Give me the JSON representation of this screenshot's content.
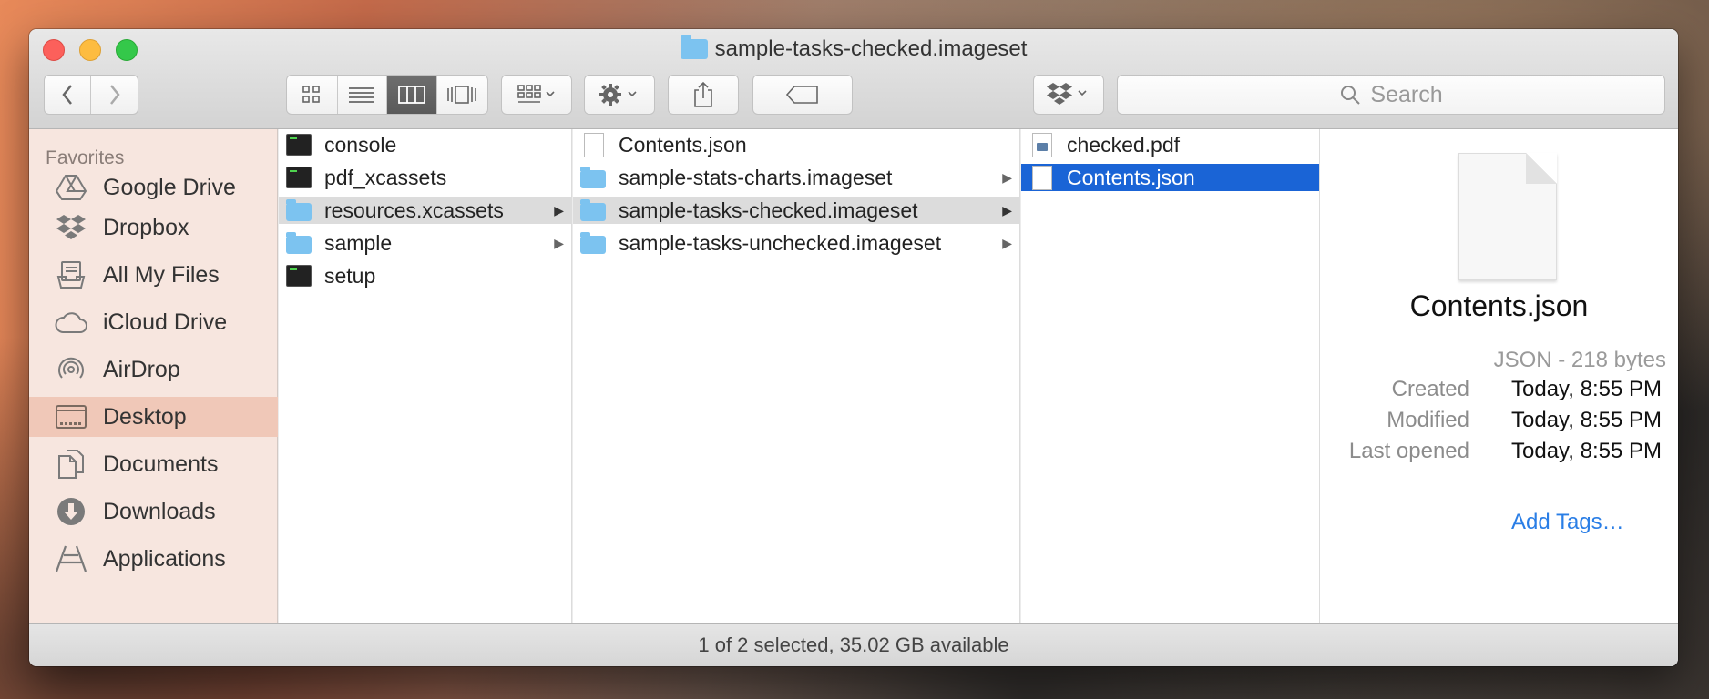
{
  "window": {
    "title": "sample-tasks-checked.imageset"
  },
  "toolbar": {
    "back_icon": "chevron-left-icon",
    "forward_icon": "chevron-right-icon",
    "view_modes": [
      "icon-view",
      "list-view",
      "column-view",
      "cover-flow-view"
    ],
    "active_view": "column-view",
    "search_placeholder": "Search"
  },
  "sidebar": {
    "heading": "Favorites",
    "items": [
      {
        "label": "Google Drive",
        "icon": "google-drive-icon"
      },
      {
        "label": "Dropbox",
        "icon": "dropbox-icon"
      },
      {
        "label": "All My Files",
        "icon": "all-files-icon"
      },
      {
        "label": "iCloud Drive",
        "icon": "cloud-icon"
      },
      {
        "label": "AirDrop",
        "icon": "airdrop-icon"
      },
      {
        "label": "Desktop",
        "icon": "desktop-icon",
        "active": true
      },
      {
        "label": "Documents",
        "icon": "documents-icon"
      },
      {
        "label": "Downloads",
        "icon": "download-icon"
      },
      {
        "label": "Applications",
        "icon": "applications-icon"
      }
    ]
  },
  "columns": [
    {
      "rows": [
        {
          "label": "console",
          "icon": "terminal-icon"
        },
        {
          "label": "pdf_xcassets",
          "icon": "terminal-icon"
        },
        {
          "label": "resources.xcassets",
          "icon": "folder-icon",
          "state": "highlighted",
          "has_children": true
        },
        {
          "label": "sample",
          "icon": "folder-icon",
          "has_children": true
        },
        {
          "label": "setup",
          "icon": "terminal-icon"
        }
      ]
    },
    {
      "rows": [
        {
          "label": "Contents.json",
          "icon": "document-icon"
        },
        {
          "label": "sample-stats-charts.imageset",
          "icon": "folder-icon",
          "has_children": true
        },
        {
          "label": "sample-tasks-checked.imageset",
          "icon": "folder-icon",
          "state": "highlighted",
          "has_children": true
        },
        {
          "label": "sample-tasks-unchecked.imageset",
          "icon": "folder-icon",
          "has_children": true
        }
      ]
    },
    {
      "rows": [
        {
          "label": "checked.pdf",
          "icon": "pdf-icon"
        },
        {
          "label": "Contents.json",
          "icon": "document-icon",
          "state": "selected"
        }
      ]
    }
  ],
  "preview": {
    "filename": "Contents.json",
    "kind": "JSON - 218 bytes",
    "meta": [
      {
        "key": "Created",
        "value": "Today, 8:55 PM"
      },
      {
        "key": "Modified",
        "value": "Today, 8:55 PM"
      },
      {
        "key": "Last opened",
        "value": "Today, 8:55 PM"
      }
    ],
    "add_tags": "Add Tags…"
  },
  "status": {
    "text": "1 of 2 selected, 35.02 GB available"
  }
}
